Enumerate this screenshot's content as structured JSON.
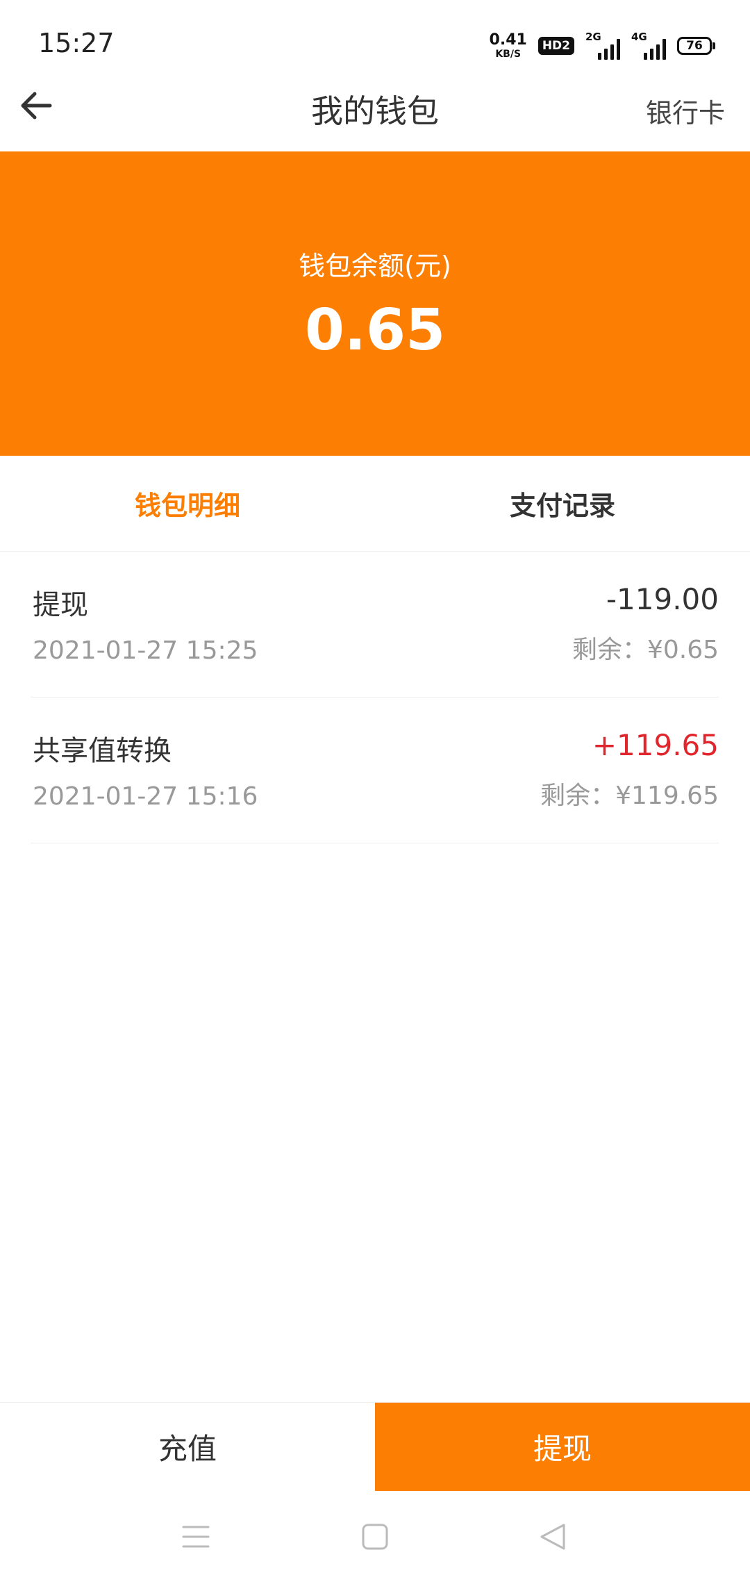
{
  "status_bar": {
    "time": "15:27",
    "net_speed_value": "0.41",
    "net_speed_unit": "KB/S",
    "hd_badge": "HD2",
    "signal_1_label": "2G",
    "signal_2_label": "4G",
    "battery_level": "76"
  },
  "header": {
    "back_icon": "arrow-left-icon",
    "title": "我的钱包",
    "right_link": "银行卡"
  },
  "balance": {
    "label": "钱包余额(元)",
    "value": "0.65"
  },
  "tabs": [
    {
      "label": "钱包明细",
      "active": true
    },
    {
      "label": "支付记录",
      "active": false
    }
  ],
  "records": [
    {
      "title": "提现",
      "date": "2021-01-27 15:25",
      "amount": "-119.00",
      "remain": "剩余：¥0.65"
    },
    {
      "title": "共享值转换",
      "date": "2021-01-27 15:16",
      "amount": "+119.65",
      "remain": "剩余：¥119.65"
    }
  ],
  "actions": {
    "recharge": "充值",
    "withdraw": "提现"
  },
  "nav": {
    "menu_icon": "menu-icon",
    "home_icon": "home-square-icon",
    "back_icon": "back-triangle-icon"
  },
  "colors": {
    "accent": "#fc7e02",
    "positive_amount": "#e0262c",
    "secondary_text": "#999999"
  }
}
